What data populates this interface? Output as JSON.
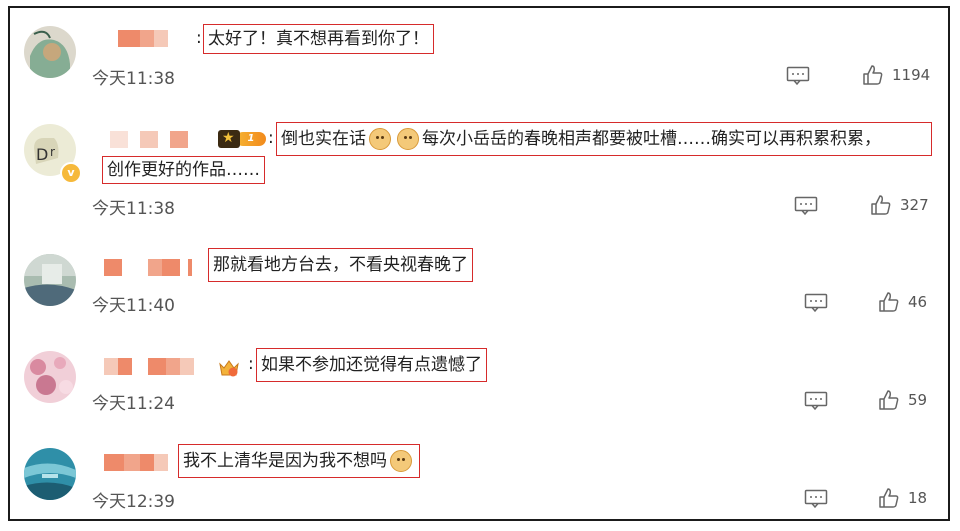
{
  "comments": [
    {
      "text": "太好了！真不想再看到你了！",
      "time": "今天11:38",
      "likes": "1194",
      "avatar_colors": [
        "#d9d4c7",
        "#7fa88f",
        "#c9a87a"
      ]
    },
    {
      "text_line1": "倒也实在话",
      "text_line1b": "每次小岳岳的春晚相声都要被吐槽……确实可以再积累积累，",
      "text_line2": "创作更好的作品……",
      "time": "今天11:38",
      "likes": "327",
      "vip_level": "1",
      "avatar_colors": [
        "#e9e9d2",
        "#8c8c6c",
        "#3a3a3a"
      ]
    },
    {
      "text": "那就看地方台去，不看央视春晚了",
      "time": "今天11:40",
      "likes": "46",
      "avatar_colors": [
        "#9fb3a6",
        "#4f6a7a",
        "#cfd6d0"
      ]
    },
    {
      "text": "如果不参加还觉得有点遗憾了",
      "time": "今天11:24",
      "likes": "59",
      "vip_level": "5",
      "avatar_colors": [
        "#d98aa0",
        "#f3c7d2",
        "#8a5a6a"
      ]
    },
    {
      "text": "我不上清华是因为我不想吗",
      "time": "今天12:39",
      "likes": "18",
      "avatar_colors": [
        "#2f8fa8",
        "#7bc7d6",
        "#1c5d72"
      ]
    }
  ],
  "colors": {
    "highlight_border": "#d62b2b",
    "name_block_dark": "#ee8a6a",
    "name_block_light": "#f5c9b8",
    "frame": "#1b1b1b"
  },
  "icons": {
    "reply": "comment-bubble-icon",
    "like": "thumbs-up-icon",
    "emoji": "doge-emoji-icon"
  }
}
